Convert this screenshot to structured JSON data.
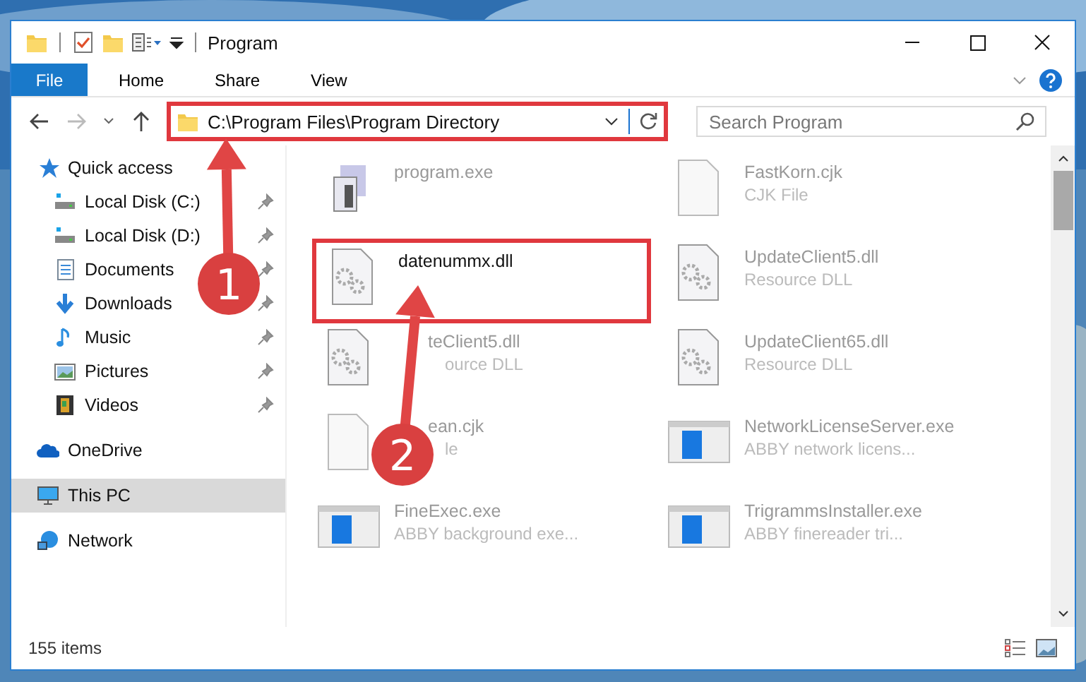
{
  "window": {
    "title": "Program"
  },
  "file_menu": "File",
  "ribbon_tabs": [
    {
      "label": "Home",
      "selected": false
    },
    {
      "label": "Share",
      "selected": false
    },
    {
      "label": "View",
      "selected": false
    }
  ],
  "address": {
    "path": "C:\\Program Files\\Program Directory",
    "highlighted": true
  },
  "search": {
    "placeholder": "Search Program"
  },
  "sidebar": {
    "items": [
      {
        "label": "Quick access",
        "kind": "star",
        "selected": false,
        "children": [
          {
            "label": "Local Disk (C:)",
            "kind": "disk",
            "pinned": true,
            "selected": false
          },
          {
            "label": "Local Disk (D:)",
            "kind": "disk",
            "pinned": true,
            "selected": false
          },
          {
            "label": "Documents",
            "kind": "doc",
            "pinned": true,
            "selected": false
          },
          {
            "label": "Downloads",
            "kind": "down",
            "pinned": true,
            "selected": false
          },
          {
            "label": "Music",
            "kind": "music",
            "pinned": true,
            "selected": false
          },
          {
            "label": "Pictures",
            "kind": "pics",
            "pinned": true,
            "selected": false
          },
          {
            "label": "Videos",
            "kind": "video",
            "pinned": true,
            "selected": false
          }
        ]
      },
      {
        "label": "OneDrive",
        "kind": "cloud",
        "selected": false
      },
      {
        "label": "This PC",
        "kind": "pc",
        "selected": true
      },
      {
        "label": "Network",
        "kind": "net",
        "selected": false
      }
    ]
  },
  "files": [
    {
      "name": "program.exe",
      "kind": "exe",
      "highlighted": false
    },
    {
      "name": "FastKorn.cjk",
      "type": "CJK File",
      "kind": "file",
      "highlighted": false
    },
    {
      "name": "datenummx.dll",
      "kind": "dll",
      "highlighted": true
    },
    {
      "name": "UpdateClient5.dll",
      "type": "Resource DLL",
      "kind": "dll",
      "highlighted": false
    },
    {
      "name": "teClient5.dll",
      "type": "ource DLL",
      "kind": "dll",
      "highlighted": false,
      "covered": true
    },
    {
      "name": "UpdateClient65.dll",
      "type": "Resource DLL",
      "kind": "dll",
      "highlighted": false
    },
    {
      "name": "ean.cjk",
      "type": "le",
      "kind": "file",
      "highlighted": false,
      "covered": true
    },
    {
      "name": "NetworkLicenseServer.exe",
      "type": "ABBY network licens...",
      "kind": "app",
      "highlighted": false
    },
    {
      "name": "FineExec.exe",
      "type": "ABBY background exe...",
      "kind": "app",
      "highlighted": false
    },
    {
      "name": "TrigrammsInstaller.exe",
      "type": "ABBY finereader tri...",
      "kind": "app",
      "highlighted": false
    }
  ],
  "callouts": [
    {
      "number": "1"
    },
    {
      "number": "2"
    }
  ],
  "status_bar": {
    "count": "155 items"
  }
}
